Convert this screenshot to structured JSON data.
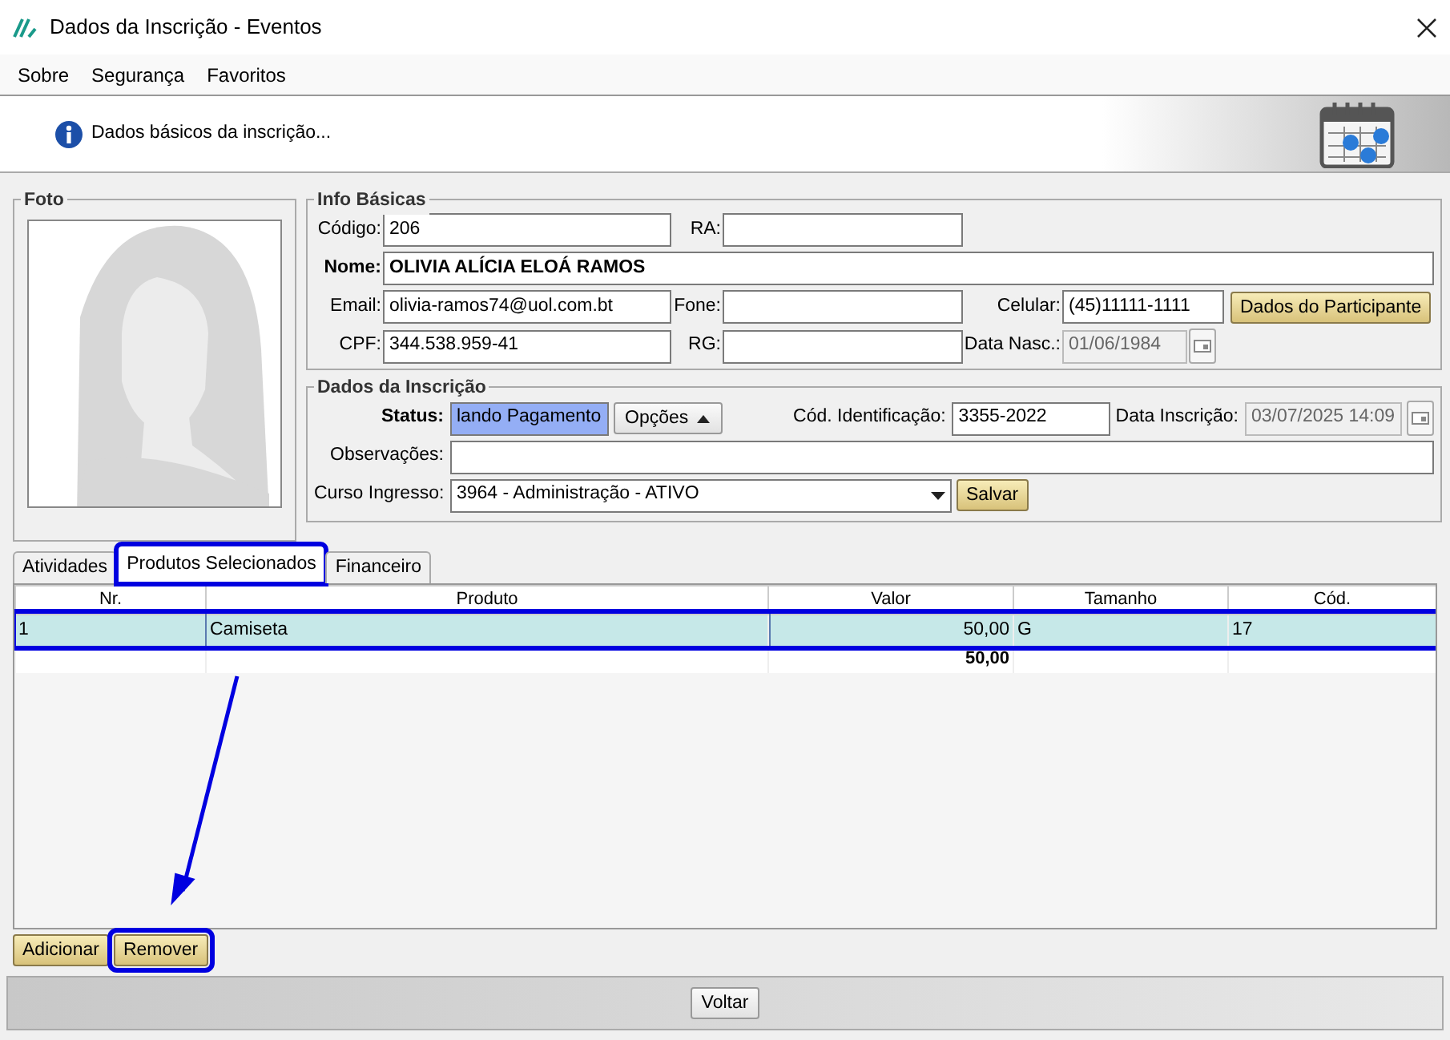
{
  "window": {
    "title": "Dados da Inscrição - Eventos"
  },
  "menu": [
    {
      "label": "Sobre"
    },
    {
      "label": "Segurança"
    },
    {
      "label": "Favoritos"
    }
  ],
  "header": {
    "message": "Dados básicos da inscrição..."
  },
  "photo_group": {
    "title": "Foto"
  },
  "info_basicas": {
    "title": "Info Básicas",
    "fields": [
      {
        "label": "Código:",
        "value": "206"
      },
      {
        "label": "RA:"
      },
      {
        "label": "Nome:",
        "value": "OLIVIA ALÍCIA ELOÁ RAMOS"
      },
      {
        "label": "Email:",
        "value": "olivia-ramos74@uol.com.bt"
      },
      {
        "label": "Fone:"
      },
      {
        "label": "Celular:",
        "value": "(45)11111-1111"
      },
      {
        "label": "CPF:",
        "value": "344.538.959-41"
      },
      {
        "label": "RG:"
      },
      {
        "label": "Data Nasc.:",
        "value": "01/06/1984",
        "disabled": true
      }
    ],
    "button": "Dados do Participante"
  },
  "dados_inscricao": {
    "title": "Dados da Inscrição",
    "status": {
      "label": "Status:",
      "value": "lando Pagamento",
      "selected": true
    },
    "options_button": "Opções",
    "cod_identificacao": {
      "label": "Cód. Identificação:",
      "value": "3355-2022"
    },
    "data_inscricao": {
      "label": "Data Inscrição:",
      "value": "03/07/2025 14:09",
      "disabled": true
    },
    "observacoes": {
      "label": "Observações:"
    },
    "curso": {
      "label": "Curso Ingresso:",
      "value": "3964 - Administração - ATIVO"
    },
    "save_button": "Salvar"
  },
  "tabs": [
    {
      "label": "Atividades",
      "selected": false,
      "highlighted": false
    },
    {
      "label": "Produtos Selecionados",
      "selected": true,
      "highlighted": true
    },
    {
      "label": "Financeiro",
      "selected": false,
      "highlighted": false
    }
  ],
  "table": {
    "columns": [
      "Nr.",
      "Produto",
      "Valor",
      "Tamanho",
      "Cód."
    ],
    "rows": [
      {
        "cells": [
          "1",
          "Camiseta",
          "50,00",
          "G",
          "17"
        ],
        "selected": true,
        "highlighted": true
      }
    ],
    "total": {
      "valor": "50,00"
    }
  },
  "buttons": [
    {
      "label": "Adicionar",
      "highlighted": false
    },
    {
      "label": "Remover",
      "highlighted": true
    }
  ],
  "annotation_arrow": {
    "visible": true
  },
  "footer": {
    "button": "Voltar"
  }
}
